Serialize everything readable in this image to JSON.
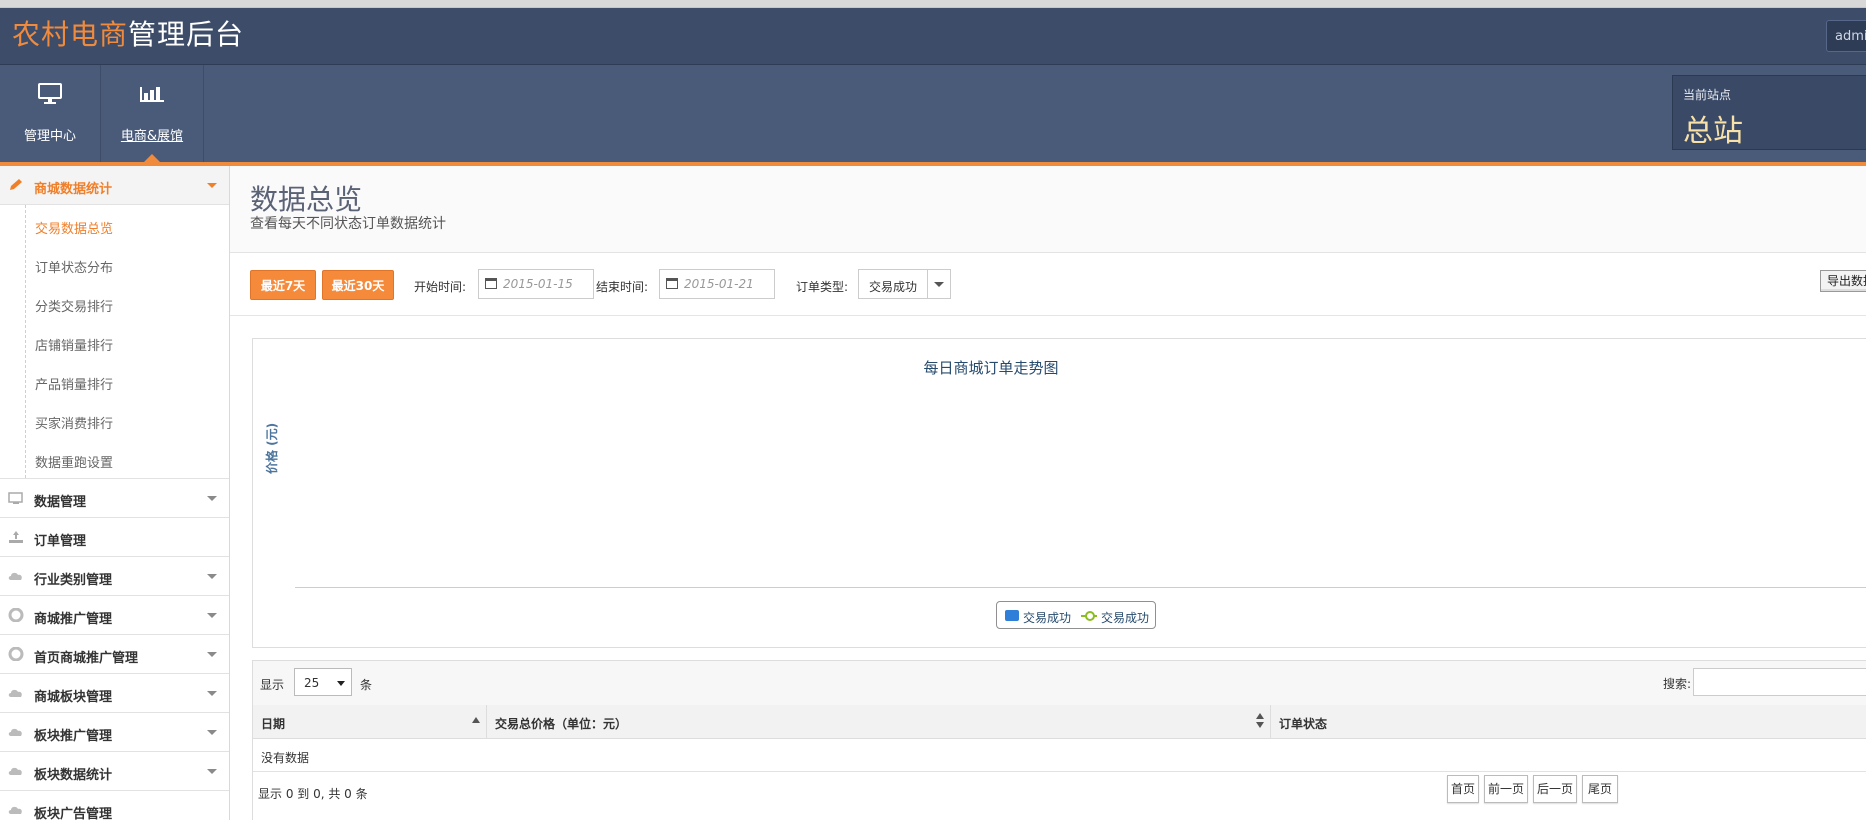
{
  "header": {
    "brand_part1": "农村电商",
    "brand_part2": "管理后台",
    "user": "admin"
  },
  "nav": {
    "items": [
      {
        "label": "管理中心",
        "icon": "monitor-icon"
      },
      {
        "label": "电商&展馆",
        "icon": "bar-chart-icon",
        "active": true
      }
    ],
    "site_label": "当前站点",
    "site_name": "总站"
  },
  "sidebar": {
    "groups": [
      {
        "label": "商城数据统计",
        "open": true
      },
      {
        "label": "数据管理"
      },
      {
        "label": "订单管理"
      },
      {
        "label": "行业类别管理"
      },
      {
        "label": "商城推广管理"
      },
      {
        "label": "首页商城推广管理"
      },
      {
        "label": "商城板块管理"
      },
      {
        "label": "板块推广管理"
      },
      {
        "label": "板块数据统计"
      },
      {
        "label": "板块广告管理"
      }
    ],
    "sub_items": [
      {
        "label": "交易数据总览",
        "active": true
      },
      {
        "label": "订单状态分布"
      },
      {
        "label": "分类交易排行"
      },
      {
        "label": "店铺销量排行"
      },
      {
        "label": "产品销量排行"
      },
      {
        "label": "买家消费排行"
      },
      {
        "label": "数据重跑设置"
      }
    ]
  },
  "page": {
    "title": "数据总览",
    "subtitle": "查看每天不同状态订单数据统计"
  },
  "toolbar": {
    "btn_7days": "最近7天",
    "btn_30days": "最近30天",
    "start_label": "开始时间:",
    "start_placeholder": "2015-01-15",
    "end_label": "结束时间:",
    "end_placeholder": "2015-01-21",
    "type_label": "订单类型:",
    "type_value": "交易成功",
    "export_label": "导出数据"
  },
  "chart_data": {
    "type": "bar",
    "title": "每日商城订单走势图",
    "ylabel": "价格 (元)",
    "xlabel": "",
    "categories": [],
    "series": [
      {
        "name": "交易成功",
        "kind": "bar",
        "color": "#2f7ed8",
        "values": []
      },
      {
        "name": "交易成功",
        "kind": "line",
        "color": "#8bbc21",
        "values": []
      }
    ],
    "legend_position": "bottom-center"
  },
  "table": {
    "show_label": "显示",
    "page_length": "25",
    "unit_label": "条",
    "search_label": "搜索:",
    "columns": [
      "日期",
      "交易总价格（单位：元）",
      "订单状态"
    ],
    "empty_text": "没有数据",
    "info": "显示 0 到 0, 共 0 条",
    "pagination": [
      "首页",
      "前一页",
      "后一页",
      "尾页"
    ]
  }
}
